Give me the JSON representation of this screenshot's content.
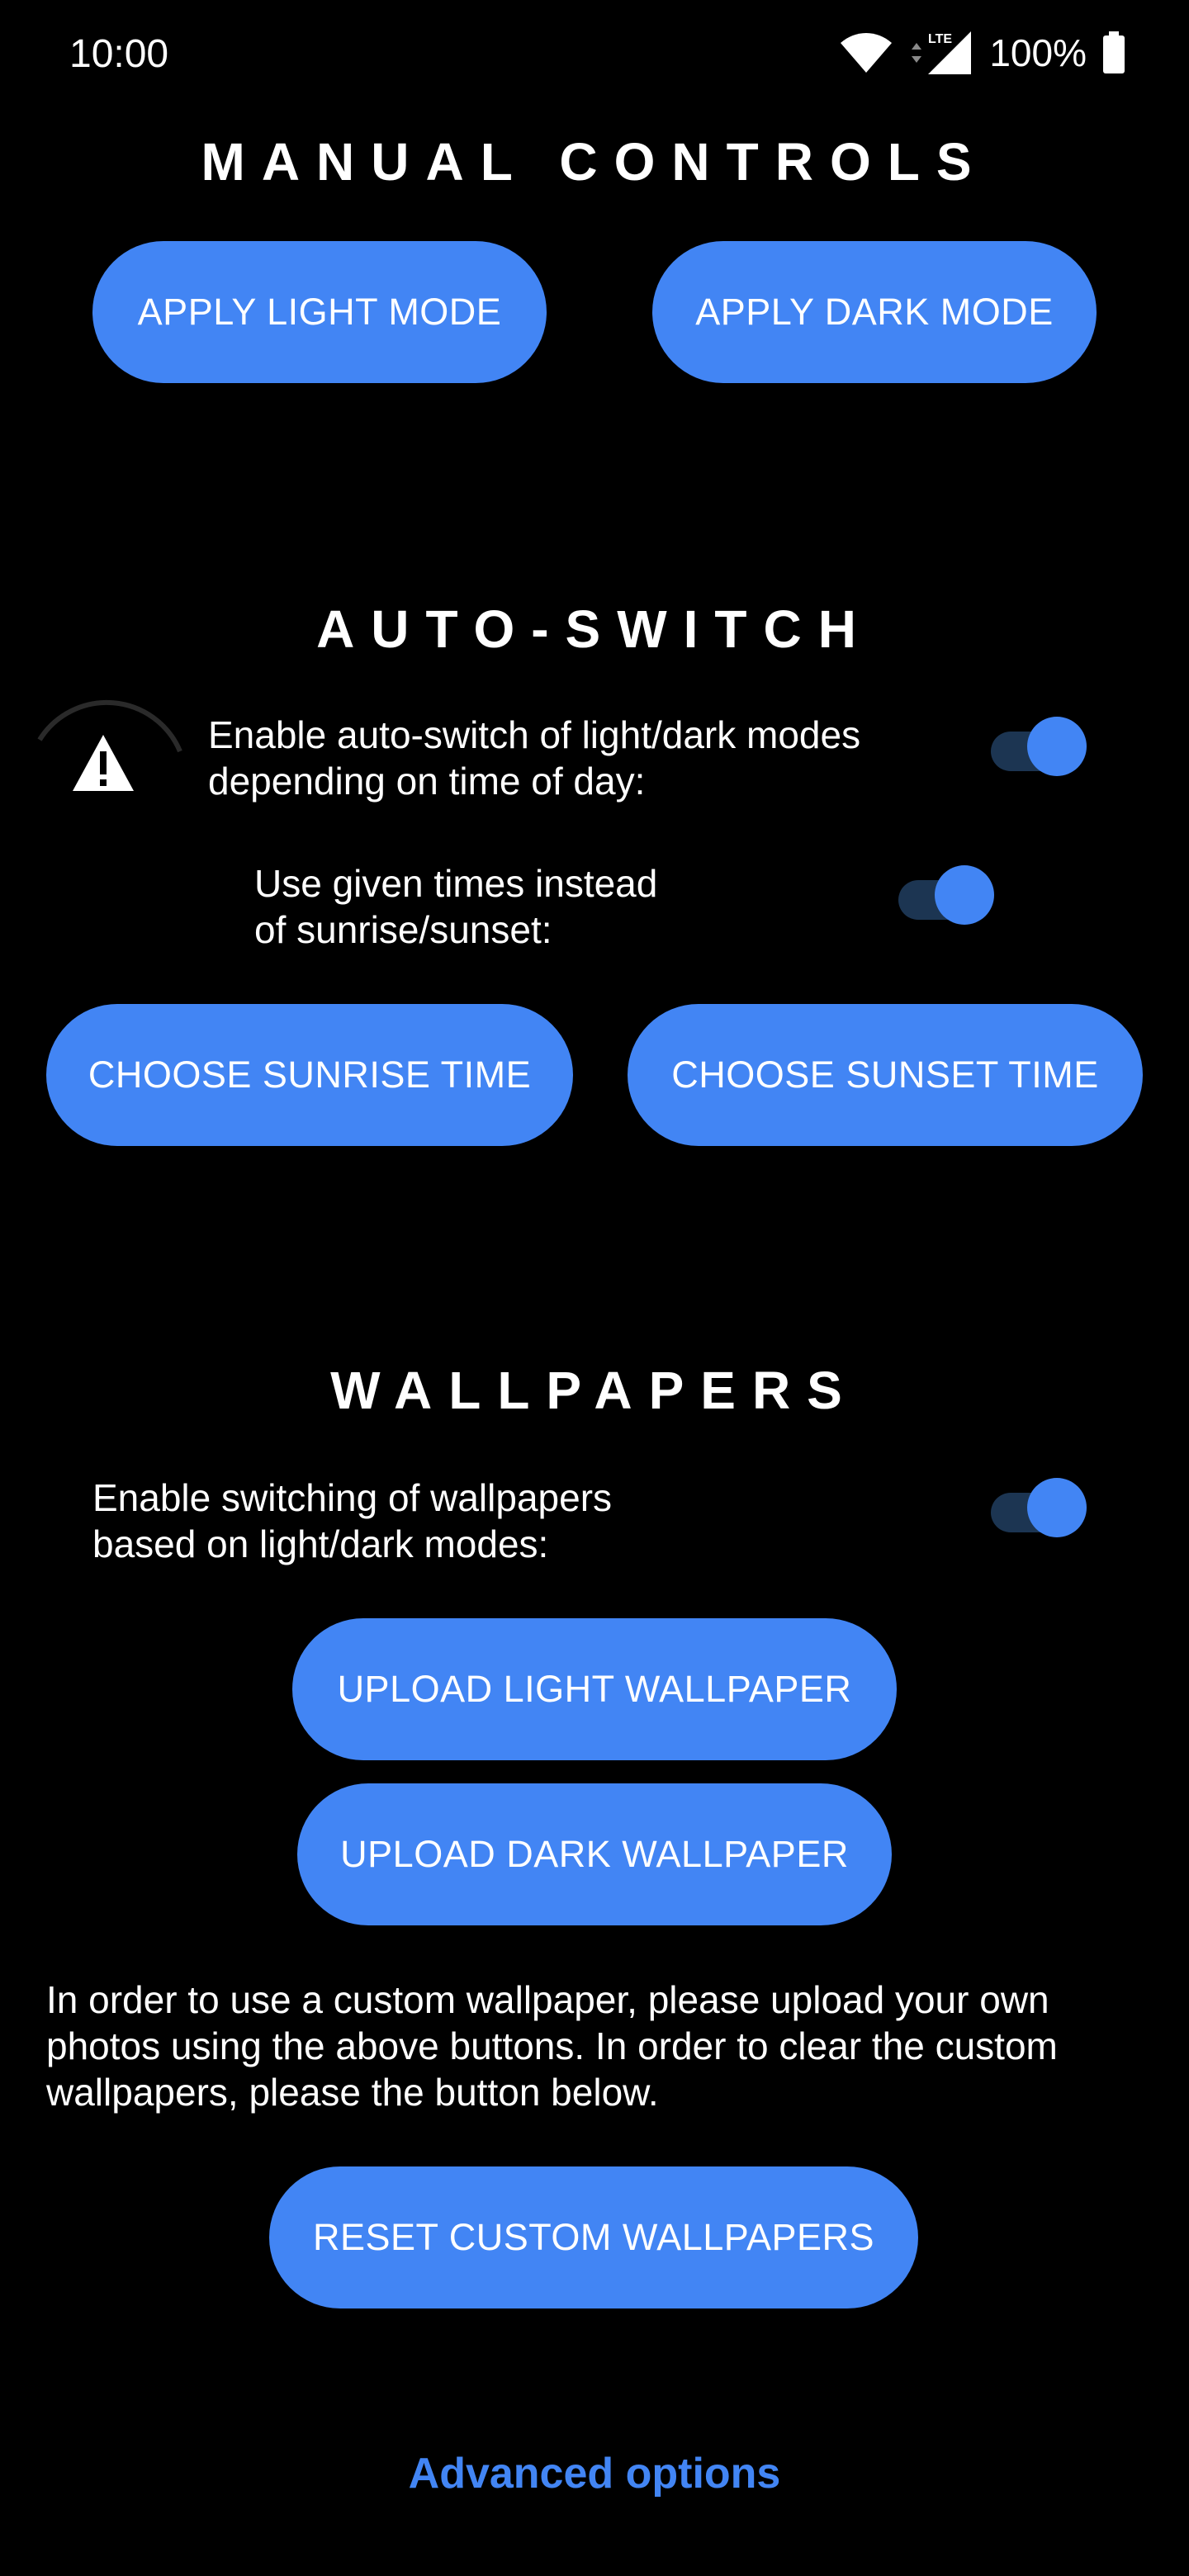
{
  "status_bar": {
    "time": "10:00",
    "network_label": "LTE",
    "battery": "100%",
    "icons": [
      "wifi-icon",
      "lte-signal-icon",
      "battery-icon"
    ]
  },
  "manual_controls": {
    "title": "MANUAL CONTROLS",
    "light_button": "APPLY LIGHT MODE",
    "dark_button": "APPLY DARK MODE"
  },
  "auto_switch": {
    "title": "AUTO-SWITCH",
    "enable_label": "Enable auto-switch of light/dark modes\ndepending on time of day:",
    "enable_on": true,
    "given_times_label": "Use given times instead\nof sunrise/sunset:",
    "given_times_on": true,
    "sunrise_button": "CHOOSE SUNRISE TIME",
    "sunset_button": "CHOOSE SUNSET TIME",
    "warning_icon": "warning-icon"
  },
  "wallpapers": {
    "title": "WALLPAPERS",
    "enable_label": "Enable switching of wallpapers\nbased on light/dark modes:",
    "enable_on": true,
    "upload_light_button": "UPLOAD LIGHT WALLPAPER",
    "upload_dark_button": "UPLOAD DARK WALLPAPER",
    "info_text": "In order to use a custom wallpaper, please upload your own\nphotos using the above buttons. In order to clear the custom\nwallpapers, please the button below.",
    "reset_button": "RESET CUSTOM WALLPAPERS"
  },
  "advanced_link": "Advanced options",
  "colors": {
    "background": "#000000",
    "accent": "#4285f4",
    "switch_track": "#1c3552",
    "text": "#ffffff"
  }
}
